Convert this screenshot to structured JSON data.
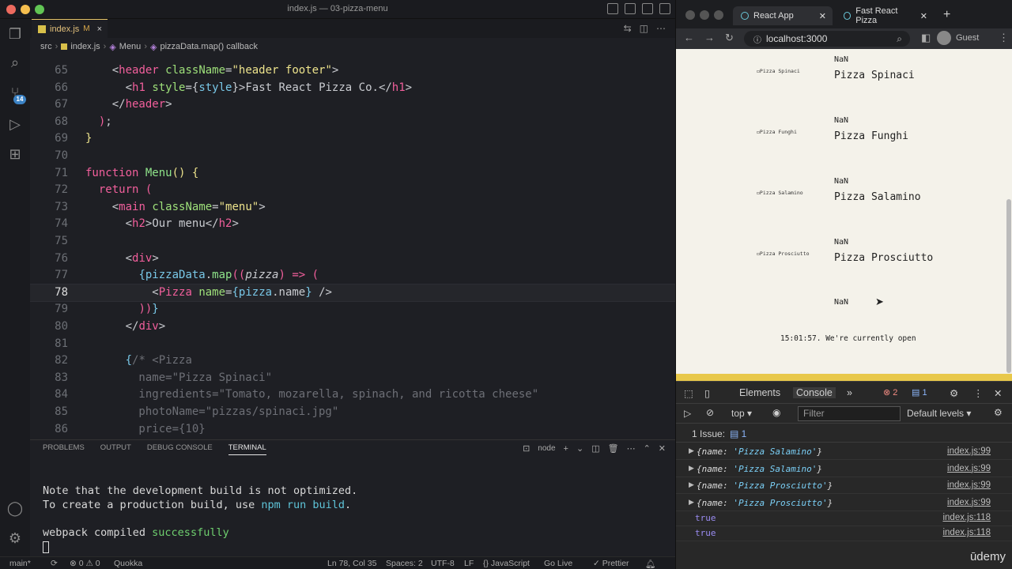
{
  "vscode": {
    "title": "index.js — 03-pizza-menu",
    "tab": {
      "name": "index.js",
      "modified": "M",
      "close": "×"
    },
    "breadcrumb": [
      "src",
      "index.js",
      "Menu",
      "pizzaData.map() callback"
    ],
    "activity_badge": "14",
    "lines": [
      {
        "n": "65",
        "html": "    <span class='p'>&lt;</span><span class='t'>header</span> <span class='a'>className</span>=<span class='s'>\"header footer\"</span><span class='p'>&gt;</span>"
      },
      {
        "n": "66",
        "html": "      <span class='p'>&lt;</span><span class='t'>h1</span> <span class='a'>style</span>={<span class='v'>style</span>}<span class='p'>&gt;</span>Fast React Pizza Co.<span class='p'>&lt;/</span><span class='t'>h1</span><span class='p'>&gt;</span>"
      },
      {
        "n": "67",
        "html": "    <span class='p'>&lt;/</span><span class='t'>header</span><span class='p'>&gt;</span>"
      },
      {
        "n": "68",
        "html": "  <span class='k'>)</span>;"
      },
      {
        "n": "69",
        "html": "<span class='s'>}</span>"
      },
      {
        "n": "70",
        "html": ""
      },
      {
        "n": "71",
        "html": "<span class='k'>function</span> <span class='f'>Menu</span><span class='s'>()</span> <span class='s'>{</span>"
      },
      {
        "n": "72",
        "html": "  <span class='k'>return</span> <span class='k'>(</span>"
      },
      {
        "n": "73",
        "html": "    <span class='p'>&lt;</span><span class='t'>main</span> <span class='a'>className</span>=<span class='s'>\"menu\"</span><span class='p'>&gt;</span>"
      },
      {
        "n": "74",
        "html": "      <span class='p'>&lt;</span><span class='t'>h2</span><span class='p'>&gt;</span>Our menu<span class='p'>&lt;/</span><span class='t'>h2</span><span class='p'>&gt;</span>"
      },
      {
        "n": "75",
        "html": ""
      },
      {
        "n": "76",
        "html": "      <span class='p'>&lt;</span><span class='t'>div</span><span class='p'>&gt;</span>"
      },
      {
        "n": "77",
        "html": "        <span class='v'>{</span><span class='v'>pizzaData</span>.<span class='f'>map</span><span class='k'>((</span><span class='pa'>pizza</span><span class='k'>)</span> <span class='k'>=&gt;</span> <span class='k'>(</span>"
      },
      {
        "n": "78",
        "html": "          <span class='p'>&lt;</span><span class='t'>Pizza</span> <span class='a'>name</span>=<span class='v'>{</span><span class='v'>pizza</span>.<span class='p'>name</span><span class='v'>}</span> <span class='p'>/&gt;</span>"
      },
      {
        "n": "79",
        "html": "        <span class='k'>))</span><span class='v'>}</span>"
      },
      {
        "n": "80",
        "html": "      <span class='p'>&lt;/</span><span class='t'>div</span><span class='p'>&gt;</span>"
      },
      {
        "n": "81",
        "html": ""
      },
      {
        "n": "82",
        "html": "      <span class='v'>{</span><span class='c'>/* &lt;Pizza</span>"
      },
      {
        "n": "83",
        "html": "<span class='c'>        name=\"Pizza Spinaci\"</span>"
      },
      {
        "n": "84",
        "html": "<span class='c'>        ingredients=\"Tomato, mozarella, spinach, and ricotta cheese\"</span>"
      },
      {
        "n": "85",
        "html": "<span class='c'>        photoName=\"pizzas/spinaci.jpg\"</span>"
      },
      {
        "n": "86",
        "html": "<span class='c'>        price={10}</span>"
      }
    ],
    "panel_tabs": [
      "PROBLEMS",
      "OUTPUT",
      "DEBUG CONSOLE",
      "TERMINAL"
    ],
    "terminal_shell": "node",
    "terminal": {
      "line1": "Note that the development build is not optimized.",
      "line2_a": "To create a production build, use ",
      "line2_b": "npm run build",
      "line2_c": ".",
      "line3_a": "webpack compiled ",
      "line3_b": "successfully"
    },
    "status": {
      "branch": "main*",
      "errors": "⊗ 0 ⚠ 0",
      "quokka": "Quokka",
      "pos": "Ln 78, Col 35",
      "spaces": "Spaces: 2",
      "enc": "UTF-8",
      "eol": "LF",
      "lang": "{} JavaScript",
      "golive": "Go Live",
      "prettier": "✓ Prettier"
    }
  },
  "browser": {
    "tab1": "React App",
    "tab2": "Fast React Pizza",
    "url": "localhost:3000",
    "guest": "Guest",
    "pizzas": [
      {
        "img": "Pizza Spinaci",
        "price": "NaN",
        "name": "Pizza Spinaci"
      },
      {
        "img": "Pizza Funghi",
        "price": "NaN",
        "name": "Pizza Funghi"
      },
      {
        "img": "Pizza Salamino",
        "price": "NaN",
        "name": "Pizza Salamino"
      },
      {
        "img": "Pizza Prosciutto",
        "price": "NaN",
        "name": "Pizza Prosciutto"
      }
    ],
    "top_nan": "NaN",
    "last_nan": "NaN",
    "footer": "15:01:57. We're currently open",
    "devtools": {
      "tabs": [
        "Elements",
        "Console"
      ],
      "errors": "2",
      "issues_count": "1",
      "context": "top",
      "filter_placeholder": "Filter",
      "levels": "Default levels",
      "issue_label": "1 Issue:",
      "issue_num": "1",
      "logs": [
        {
          "key": "name",
          "val": "'Pizza Salamino'",
          "src": "index.js:99"
        },
        {
          "key": "name",
          "val": "'Pizza Salamino'",
          "src": "index.js:99"
        },
        {
          "key": "name",
          "val": "'Pizza Prosciutto'",
          "src": "index.js:99"
        },
        {
          "key": "name",
          "val": "'Pizza Prosciutto'",
          "src": "index.js:99"
        }
      ],
      "bools": [
        {
          "val": "true",
          "src": "index.js:118"
        },
        {
          "val": "true",
          "src": "index.js:118"
        }
      ]
    }
  },
  "watermark": "ūdemy",
  "colors": {
    "accent": "#e8c84a",
    "vscode_bg": "#1e1f24",
    "page_bg": "#f4f2ea"
  }
}
